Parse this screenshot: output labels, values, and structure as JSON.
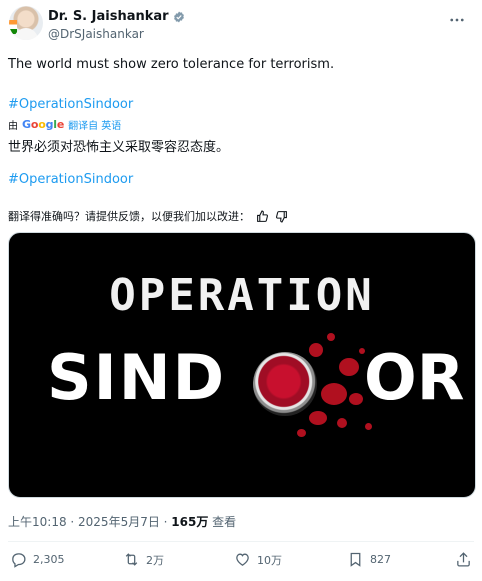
{
  "author": {
    "name": "Dr. S. Jaishankar",
    "handle": "@DrSJaishankar",
    "verified_color": "#829aab"
  },
  "tweet": {
    "text": "The world must show zero tolerance for terrorism.",
    "hashtag": "#OperationSindoor",
    "translation_prefix": "由",
    "translation_provider": [
      "G",
      "o",
      "o",
      "g",
      "l",
      "e"
    ],
    "translation_link": "翻译自 英语",
    "translated_text": "世界必须对恐怖主义采取零容忍态度。",
    "translated_hashtag": "#OperationSindoor",
    "feedback_prompt": "翻译得准确吗？请提供反馈，以便我们加以改进："
  },
  "media": {
    "line1": "OPERATION",
    "line2": "SIND",
    "line3": "OR"
  },
  "meta": {
    "time": "上午10:18 · 2025年5月7日 · ",
    "views": "165万",
    "views_label": " 查看"
  },
  "actions": {
    "replies": "2,305",
    "reposts": "2万",
    "likes": "10万",
    "bookmarks": "827"
  },
  "colors": {
    "link": "#1d9bf0",
    "secondary_text": "#536471",
    "accent_red": "#c8102e"
  }
}
